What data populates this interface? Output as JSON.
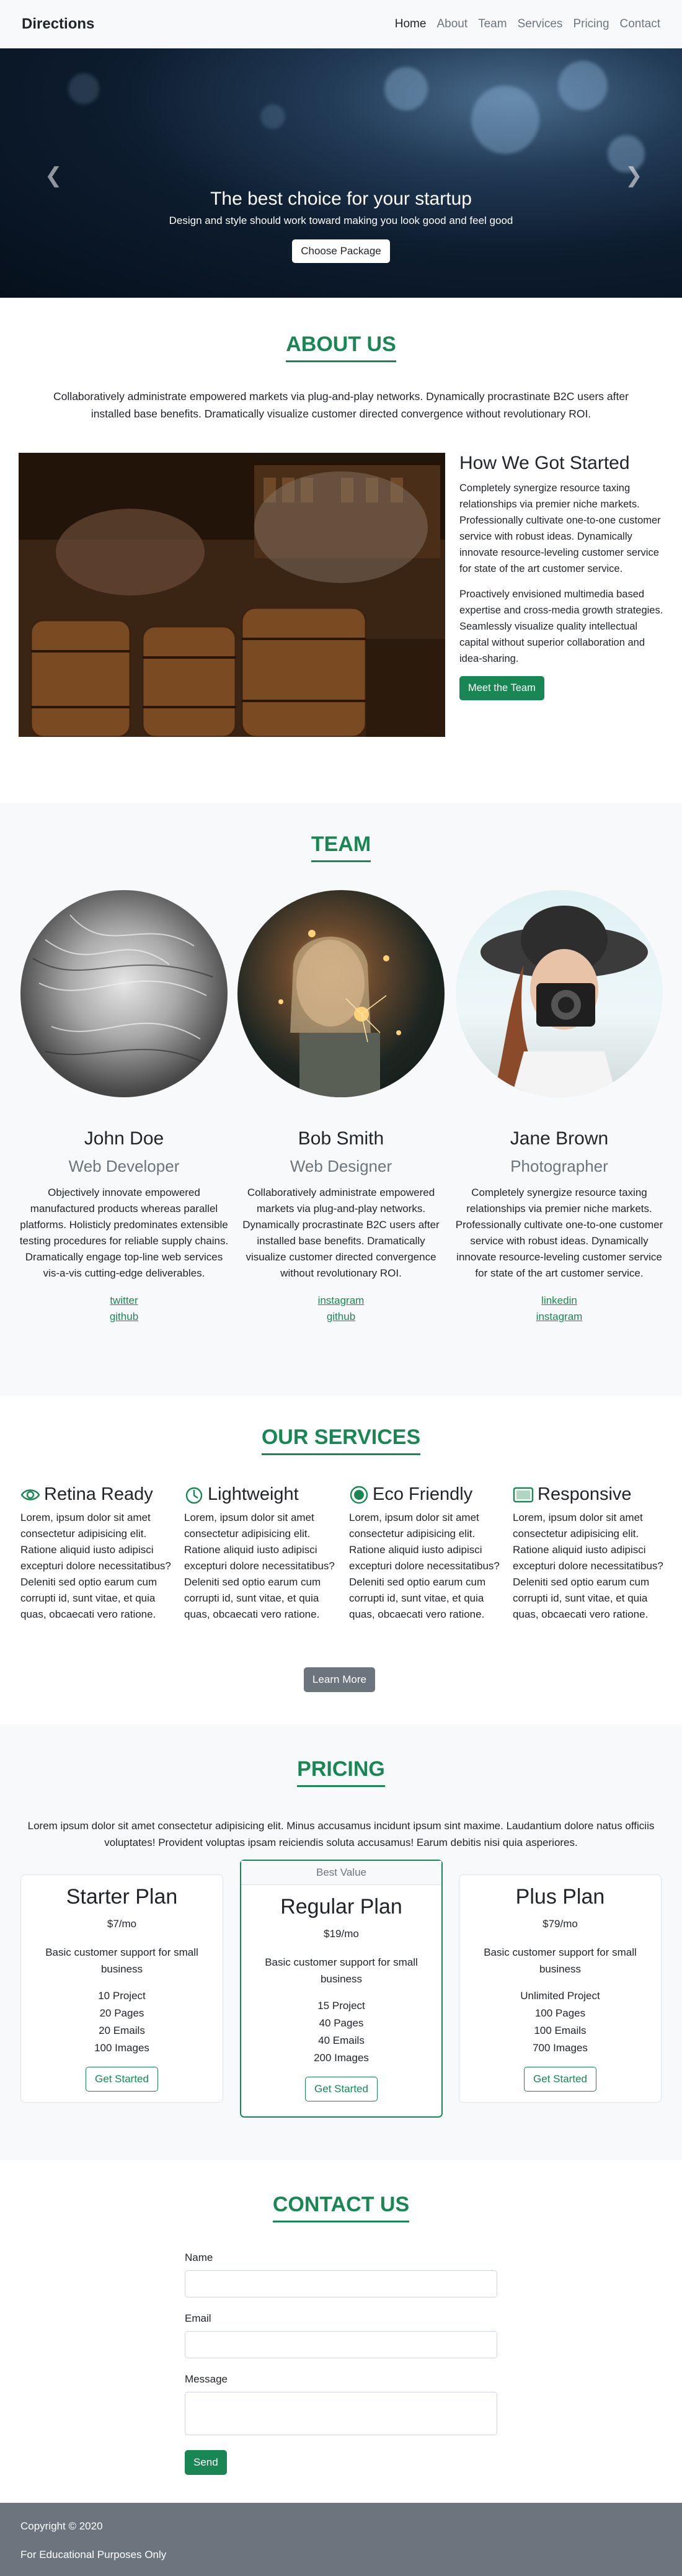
{
  "nav": {
    "brand": "Directions",
    "links": [
      "Home",
      "About",
      "Team",
      "Services",
      "Pricing",
      "Contact"
    ]
  },
  "hero": {
    "title": "The best choice for your startup",
    "subtitle": "Design and style should work toward making you look good and feel good",
    "button": "Choose Package",
    "prev_icon": "chevron-left-icon",
    "next_icon": "chevron-right-icon"
  },
  "about": {
    "title": "ABOUT US",
    "intro": "Collaboratively administrate empowered markets via plug-and-play networks. Dynamically procrastinate B2C users after installed base benefits. Dramatically visualize customer directed convergence without revolutionary ROI.",
    "heading": "How We Got Started",
    "p1": "Completely synergize resource taxing relationships via premier niche markets. Professionally cultivate one-to-one customer service with robust ideas. Dynamically innovate resource-leveling customer service for state of the art customer service.",
    "p2": "Proactively envisioned multimedia based expertise and cross-media growth strategies. Seamlessly visualize quality intellectual capital without superior collaboration and idea-sharing.",
    "button": "Meet the Team"
  },
  "team": {
    "title": "TEAM",
    "members": [
      {
        "name": "John Doe",
        "role": "Web Developer",
        "bio": "Objectively innovate empowered manufactured products whereas parallel platforms. Holisticly predominates extensible testing procedures for reliable supply chains. Dramatically engage top-line web services vis-a-vis cutting-edge deliverables.",
        "links": [
          "twitter",
          "github"
        ]
      },
      {
        "name": "Bob Smith",
        "role": "Web Designer",
        "bio": "Collaboratively administrate empowered markets via plug-and-play networks. Dynamically procrastinate B2C users after installed base benefits. Dramatically visualize customer directed convergence without revolutionary ROI.",
        "links": [
          "instagram",
          "github"
        ]
      },
      {
        "name": "Jane Brown",
        "role": "Photographer",
        "bio": "Completely synergize resource taxing relationships via premier niche markets. Professionally cultivate one-to-one customer service with robust ideas. Dynamically innovate resource-leveling customer service for state of the art customer service.",
        "links": [
          "linkedin",
          "instagram"
        ]
      }
    ]
  },
  "services": {
    "title": "OUR SERVICES",
    "items": [
      {
        "title": "Retina Ready",
        "icon": "eye-icon",
        "text": "Lorem, ipsum dolor sit amet consectetur adipisicing elit. Ratione aliquid iusto adipisci excepturi dolore necessitatibus? Deleniti sed optio earum cum corrupti id, sunt vitae, et quia quas, obcaecati vero ratione."
      },
      {
        "title": "Lightweight",
        "icon": "stopwatch-icon",
        "text": "Lorem, ipsum dolor sit amet consectetur adipisicing elit. Ratione aliquid iusto adipisci excepturi dolore necessitatibus? Deleniti sed optio earum cum corrupti id, sunt vitae, et quia quas, obcaecati vero ratione."
      },
      {
        "title": "Eco Friendly",
        "icon": "gear-icon",
        "text": "Lorem, ipsum dolor sit amet consectetur adipisicing elit. Ratione aliquid iusto adipisci excepturi dolore necessitatibus? Deleniti sed optio earum cum corrupti id, sunt vitae, et quia quas, obcaecati vero ratione."
      },
      {
        "title": "Responsive",
        "icon": "tablet-icon",
        "text": "Lorem, ipsum dolor sit amet consectetur adipisicing elit. Ratione aliquid iusto adipisci excepturi dolore necessitatibus? Deleniti sed optio earum cum corrupti id, sunt vitae, et quia quas, obcaecati vero ratione."
      }
    ],
    "button": "Learn More"
  },
  "pricing": {
    "title": "PRICING",
    "intro": "Lorem ipsum dolor sit amet consectetur adipisicing elit. Minus accusamus incidunt ipsum sint maxime. Laudantium dolore natus officiis voluptates! Provident voluptas ipsam reiciendis soluta accusamus! Earum debitis nisi quia asperiores.",
    "plans": [
      {
        "name": "Starter Plan",
        "price": "$7/mo",
        "desc": "Basic customer support for small business",
        "features": [
          "10 Project",
          "20 Pages",
          "20 Emails",
          "100 Images"
        ],
        "button": "Get Started"
      },
      {
        "badge": "Best Value",
        "name": "Regular Plan",
        "price": "$19/mo",
        "desc": "Basic customer support for small business",
        "features": [
          "15 Project",
          "40 Pages",
          "40 Emails",
          "200 Images"
        ],
        "button": "Get Started"
      },
      {
        "name": "Plus Plan",
        "price": "$79/mo",
        "desc": "Basic customer support for small business",
        "features": [
          "Unlimited Project",
          "100 Pages",
          "100 Emails",
          "700 Images"
        ],
        "button": "Get Started"
      }
    ]
  },
  "contact": {
    "title": "CONTACT US",
    "name_label": "Name",
    "email_label": "Email",
    "message_label": "Message",
    "button": "Send"
  },
  "footer": {
    "copyright": "Copyright © 2020",
    "note": "For Educational Purposes Only"
  },
  "colors": {
    "accent": "#198754",
    "secondary": "#6c757d",
    "light_bg": "#f8f9fa"
  }
}
